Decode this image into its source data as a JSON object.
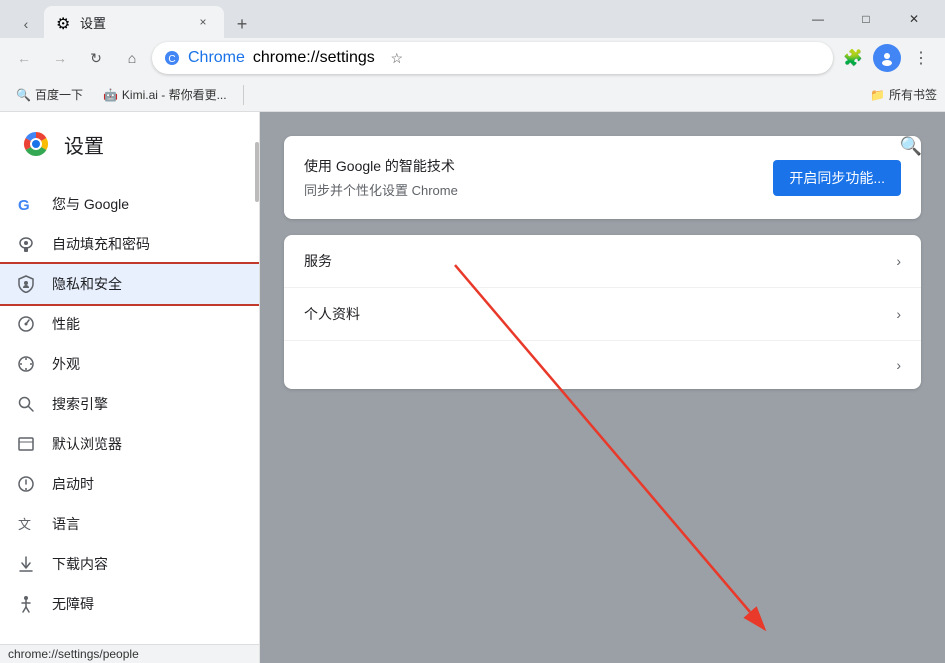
{
  "browser": {
    "tab": {
      "favicon": "⚙",
      "title": "设置",
      "close_label": "×"
    },
    "new_tab_label": "+",
    "window_controls": {
      "minimize": "—",
      "maximize": "□",
      "close": "✕"
    },
    "nav": {
      "back": "←",
      "forward": "→",
      "reload": "↻",
      "home": "⌂"
    },
    "address": {
      "site_name": "Chrome",
      "url": "chrome://settings"
    },
    "toolbar": {
      "bookmark": "☆",
      "extensions": "🧩",
      "profile": "👤",
      "menu": "⋮"
    },
    "bookmarks": {
      "items": [
        {
          "label": "百度一下",
          "icon": "🔍"
        },
        {
          "label": "Kimi.ai - 帮你看更...",
          "icon": "🤖"
        }
      ],
      "right_label": "所有书签",
      "folder_icon": "📁"
    }
  },
  "sidebar": {
    "title": "设置",
    "nav_items": [
      {
        "id": "google",
        "icon": "G",
        "label": "您与 Google",
        "active": false
      },
      {
        "id": "autofill",
        "icon": "🔑",
        "label": "自动填充和密码",
        "active": false
      },
      {
        "id": "privacy",
        "icon": "🛡",
        "label": "隐私和安全",
        "active": true
      },
      {
        "id": "performance",
        "icon": "📊",
        "label": "性能",
        "active": false
      },
      {
        "id": "appearance",
        "icon": "🌐",
        "label": "外观",
        "active": false
      },
      {
        "id": "search",
        "icon": "🔍",
        "label": "搜索引擎",
        "active": false
      },
      {
        "id": "browser",
        "icon": "⬜",
        "label": "默认浏览器",
        "active": false
      },
      {
        "id": "startup",
        "icon": "⏻",
        "label": "启动时",
        "active": false
      },
      {
        "id": "language",
        "icon": "文",
        "label": "语言",
        "active": false
      },
      {
        "id": "downloads",
        "icon": "⬇",
        "label": "下载内容",
        "active": false
      },
      {
        "id": "accessibility",
        "icon": "♿",
        "label": "无障碍",
        "active": false
      }
    ]
  },
  "content": {
    "search_icon": "🔍",
    "sync_card": {
      "title": "使用 Google 的智能技术",
      "subtitle": "同步并个性化设置 Chrome",
      "button_label": "开启同步功能..."
    },
    "rows": [
      {
        "label": "服务"
      },
      {
        "label": "个人资料"
      },
      {
        "label": ""
      }
    ]
  },
  "status_bar": {
    "url": "chrome://settings/people"
  }
}
